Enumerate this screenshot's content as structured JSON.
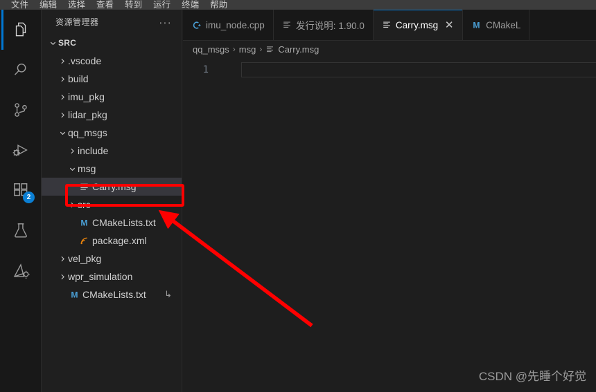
{
  "menubar": {
    "items": [
      {
        "label": "文件"
      },
      {
        "label": "编辑"
      },
      {
        "label": "选择"
      },
      {
        "label": "查看"
      },
      {
        "label": "转到"
      },
      {
        "label": "运行"
      },
      {
        "label": "终端"
      },
      {
        "label": "帮助"
      }
    ]
  },
  "activitybar": {
    "items": [
      {
        "name": "explorer",
        "icon": "files-icon",
        "active": true,
        "badge": ""
      },
      {
        "name": "search",
        "icon": "search-icon",
        "active": false,
        "badge": ""
      },
      {
        "name": "source-control",
        "icon": "source-control-icon",
        "active": false,
        "badge": ""
      },
      {
        "name": "run-and-debug",
        "icon": "run-debug-icon",
        "active": false,
        "badge": ""
      },
      {
        "name": "extensions",
        "icon": "extensions-icon",
        "active": false,
        "badge": "2"
      },
      {
        "name": "testing",
        "icon": "beaker-icon",
        "active": false,
        "badge": ""
      },
      {
        "name": "ros",
        "icon": "ros-icon",
        "active": false,
        "badge": ""
      }
    ]
  },
  "sidebar": {
    "title": "资源管理器",
    "more_actions": "···",
    "tree": [
      {
        "label": "SRC",
        "indent": 0,
        "type": "root",
        "state": "expanded",
        "icon": "",
        "selected": false,
        "trail": ""
      },
      {
        "label": ".vscode",
        "indent": 1,
        "type": "folder",
        "state": "collapsed",
        "icon": "",
        "selected": false,
        "trail": ""
      },
      {
        "label": "build",
        "indent": 1,
        "type": "folder",
        "state": "collapsed",
        "icon": "",
        "selected": false,
        "trail": ""
      },
      {
        "label": "imu_pkg",
        "indent": 1,
        "type": "folder",
        "state": "collapsed",
        "icon": "",
        "selected": false,
        "trail": ""
      },
      {
        "label": "lidar_pkg",
        "indent": 1,
        "type": "folder",
        "state": "collapsed",
        "icon": "",
        "selected": false,
        "trail": ""
      },
      {
        "label": "qq_msgs",
        "indent": 1,
        "type": "folder",
        "state": "expanded",
        "icon": "",
        "selected": false,
        "trail": ""
      },
      {
        "label": "include",
        "indent": 2,
        "type": "folder",
        "state": "collapsed",
        "icon": "",
        "selected": false,
        "trail": ""
      },
      {
        "label": "msg",
        "indent": 2,
        "type": "folder",
        "state": "expanded",
        "icon": "",
        "selected": false,
        "trail": ""
      },
      {
        "label": "Carry.msg",
        "indent": 3,
        "type": "file",
        "state": "none",
        "icon": "msg-file-icon",
        "selected": true,
        "trail": ""
      },
      {
        "label": "src",
        "indent": 2,
        "type": "folder",
        "state": "collapsed",
        "icon": "",
        "selected": false,
        "trail": ""
      },
      {
        "label": "CMakeLists.txt",
        "indent": 2,
        "type": "file",
        "state": "none",
        "icon": "cmake-icon",
        "selected": false,
        "trail": ""
      },
      {
        "label": "package.xml",
        "indent": 2,
        "type": "file",
        "state": "none",
        "icon": "xml-icon",
        "selected": false,
        "trail": ""
      },
      {
        "label": "vel_pkg",
        "indent": 1,
        "type": "folder",
        "state": "collapsed",
        "icon": "",
        "selected": false,
        "trail": ""
      },
      {
        "label": "wpr_simulation",
        "indent": 1,
        "type": "folder",
        "state": "collapsed",
        "icon": "",
        "selected": false,
        "trail": ""
      },
      {
        "label": "CMakeLists.txt",
        "indent": 1,
        "type": "file",
        "state": "none",
        "icon": "cmake-icon",
        "selected": false,
        "trail": "↳"
      }
    ]
  },
  "editor": {
    "tabs": [
      {
        "label": "imu_node.cpp",
        "icon": "cpp-icon",
        "active": false,
        "close": ""
      },
      {
        "label": "发行说明: 1.90.0",
        "icon": "msg-file-icon",
        "active": false,
        "close": ""
      },
      {
        "label": "Carry.msg",
        "icon": "msg-file-icon",
        "active": true,
        "close": "✕"
      },
      {
        "label": "CMakeL",
        "icon": "cmake-icon",
        "active": false,
        "close": ""
      }
    ],
    "breadcrumb": [
      {
        "label": "qq_msgs",
        "icon": ""
      },
      {
        "label": "msg",
        "icon": ""
      },
      {
        "label": "Carry.msg",
        "icon": "msg-file-icon"
      }
    ],
    "breadcrumb_separator": "›",
    "lines": [
      {
        "number": "1",
        "text": ""
      }
    ]
  },
  "annotations": {
    "watermark": "CSDN @先睡个好觉",
    "highlight_color": "#ff0000",
    "arrow_color": "#ff0000"
  },
  "colors": {
    "accent": "#0078d4",
    "background": "#1e1e1e",
    "sidebar_background": "#1f1f1f",
    "activitybar_background": "#181818",
    "selection": "#37373d",
    "badge": "#0b7fd4",
    "cmake_icon": "#4a9fd5",
    "xml_icon": "#e8830c"
  }
}
